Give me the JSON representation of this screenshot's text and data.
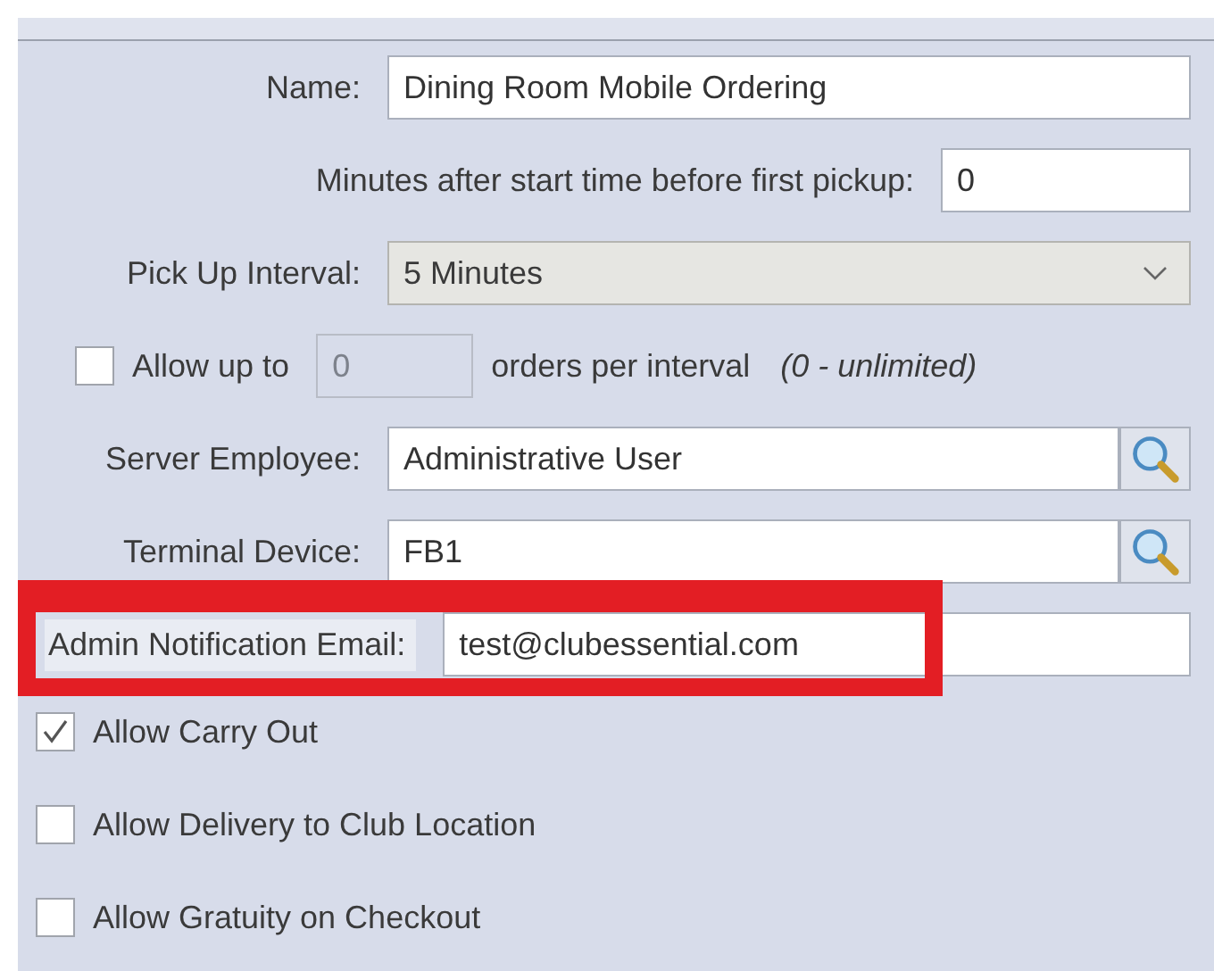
{
  "fields": [
    {
      "kind": "text",
      "label": "Name:",
      "value": "Dining Room Mobile Ordering"
    },
    {
      "kind": "number",
      "label": "Minutes after start time before first pickup:",
      "value": "0"
    },
    {
      "kind": "dropdown",
      "label": "Pick Up Interval:",
      "value": "5 Minutes"
    },
    {
      "kind": "limit",
      "label": "Allow up to",
      "checked": false,
      "value": "0",
      "suffix": "orders per interval",
      "note": "(0 - unlimited)"
    },
    {
      "kind": "lookup",
      "label": "Server Employee:",
      "value": "Administrative User"
    },
    {
      "kind": "lookup",
      "label": "Terminal Device:",
      "value": "FB1"
    },
    {
      "kind": "text",
      "label": "Admin Notification Email:",
      "value": "test@clubessential.com",
      "highlighted": true
    }
  ],
  "checkboxes": [
    {
      "label": "Allow Carry Out",
      "checked": true
    },
    {
      "label": "Allow Delivery to Club Location",
      "checked": false
    },
    {
      "label": "Allow Gratuity on Checkout",
      "checked": false
    }
  ]
}
